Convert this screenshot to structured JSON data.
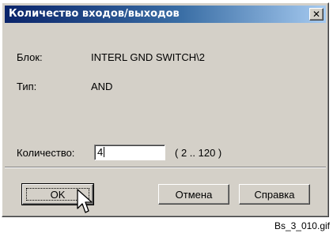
{
  "window": {
    "title": "Количество входов/выходов",
    "close_glyph": "✕"
  },
  "fields": {
    "block_label": "Блок:",
    "block_value": "INTERL GND SWITCH\\2",
    "type_label": "Тип:",
    "type_value": "AND",
    "count_label": "Количество:",
    "count_value": "4",
    "count_range": "( 2 .. 120 )"
  },
  "buttons": {
    "ok": "OK",
    "cancel": "Отмена",
    "help": "Справка"
  },
  "caption": "Bs_3_010.gif",
  "colors": {
    "dialog_bg": "#d4d0c8",
    "title_gradient_start": "#0a246a",
    "title_gradient_end": "#a6caf0"
  },
  "icons": {
    "close": "close-icon",
    "pointer": "mouse-pointer-icon"
  }
}
